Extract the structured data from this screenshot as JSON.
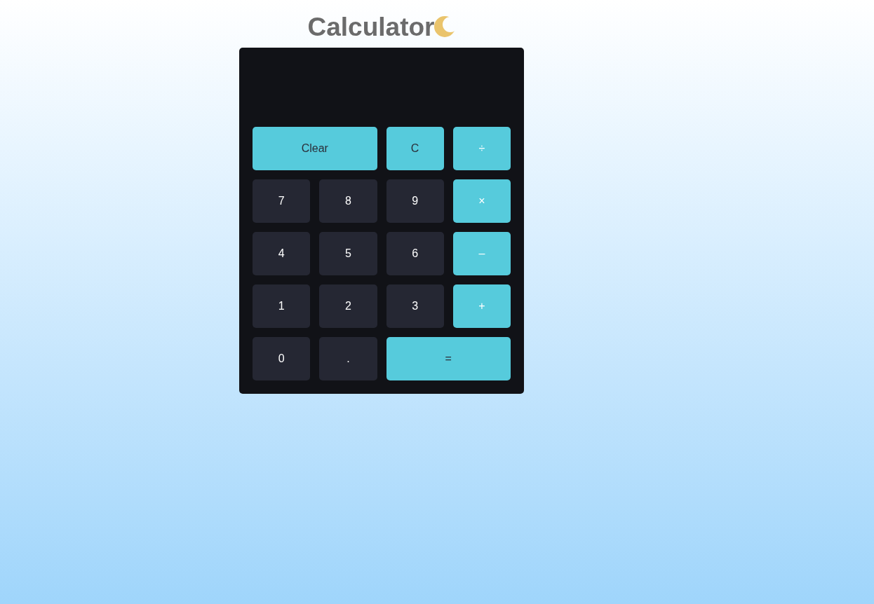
{
  "title": "Calculator",
  "keys": [
    {
      "label": "Clear",
      "kind": "clear",
      "wide": true
    },
    {
      "label": "C",
      "kind": "clear",
      "wide": false
    },
    {
      "label": "÷",
      "kind": "operator",
      "wide": false
    },
    {
      "label": "7",
      "kind": "digit",
      "wide": false
    },
    {
      "label": "8",
      "kind": "digit",
      "wide": false
    },
    {
      "label": "9",
      "kind": "digit",
      "wide": false
    },
    {
      "label": "×",
      "kind": "operator",
      "wide": false
    },
    {
      "label": "4",
      "kind": "digit",
      "wide": false
    },
    {
      "label": "5",
      "kind": "digit",
      "wide": false
    },
    {
      "label": "6",
      "kind": "digit",
      "wide": false
    },
    {
      "label": "–",
      "kind": "operator",
      "wide": false
    },
    {
      "label": "1",
      "kind": "digit",
      "wide": false
    },
    {
      "label": "2",
      "kind": "digit",
      "wide": false
    },
    {
      "label": "3",
      "kind": "digit",
      "wide": false
    },
    {
      "label": "+",
      "kind": "operator",
      "wide": false
    },
    {
      "label": "0",
      "kind": "digit",
      "wide": false
    },
    {
      "label": ".",
      "kind": "digit",
      "wide": false
    },
    {
      "label": "=",
      "kind": "equals",
      "wide": true
    }
  ]
}
